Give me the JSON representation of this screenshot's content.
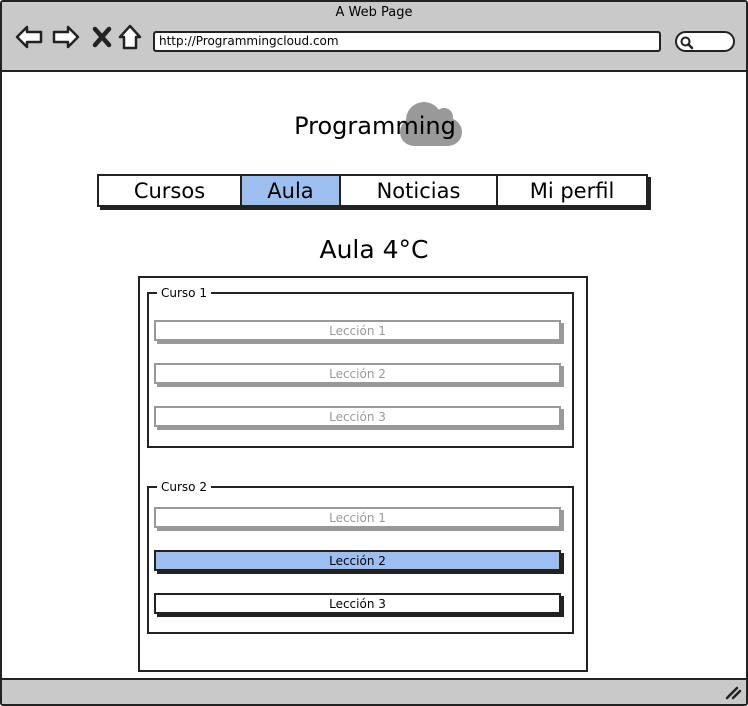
{
  "browser": {
    "window_title": "A Web Page",
    "url": "http://Programmingcloud.com"
  },
  "logo": {
    "text": "Programming"
  },
  "tabs": [
    {
      "label": "Cursos",
      "active": false
    },
    {
      "label": "Aula",
      "active": true
    },
    {
      "label": "Noticias",
      "active": false
    },
    {
      "label": "Mi perfil",
      "active": false
    }
  ],
  "page_title": "Aula 4°C",
  "courses": [
    {
      "label": "Curso 1",
      "lessons": [
        {
          "label": "Lección 1",
          "state": "disabled"
        },
        {
          "label": "Lección 2",
          "state": "disabled"
        },
        {
          "label": "Lección 3",
          "state": "disabled"
        }
      ]
    },
    {
      "label": "Curso 2",
      "lessons": [
        {
          "label": "Lección 1",
          "state": "disabled"
        },
        {
          "label": "Lección 2",
          "state": "selected"
        },
        {
          "label": "Lección 3",
          "state": "normal"
        }
      ]
    }
  ],
  "colors": {
    "accent": "#9dbff0",
    "chrome": "#c9c9c9",
    "disabled_text": "#999999"
  }
}
